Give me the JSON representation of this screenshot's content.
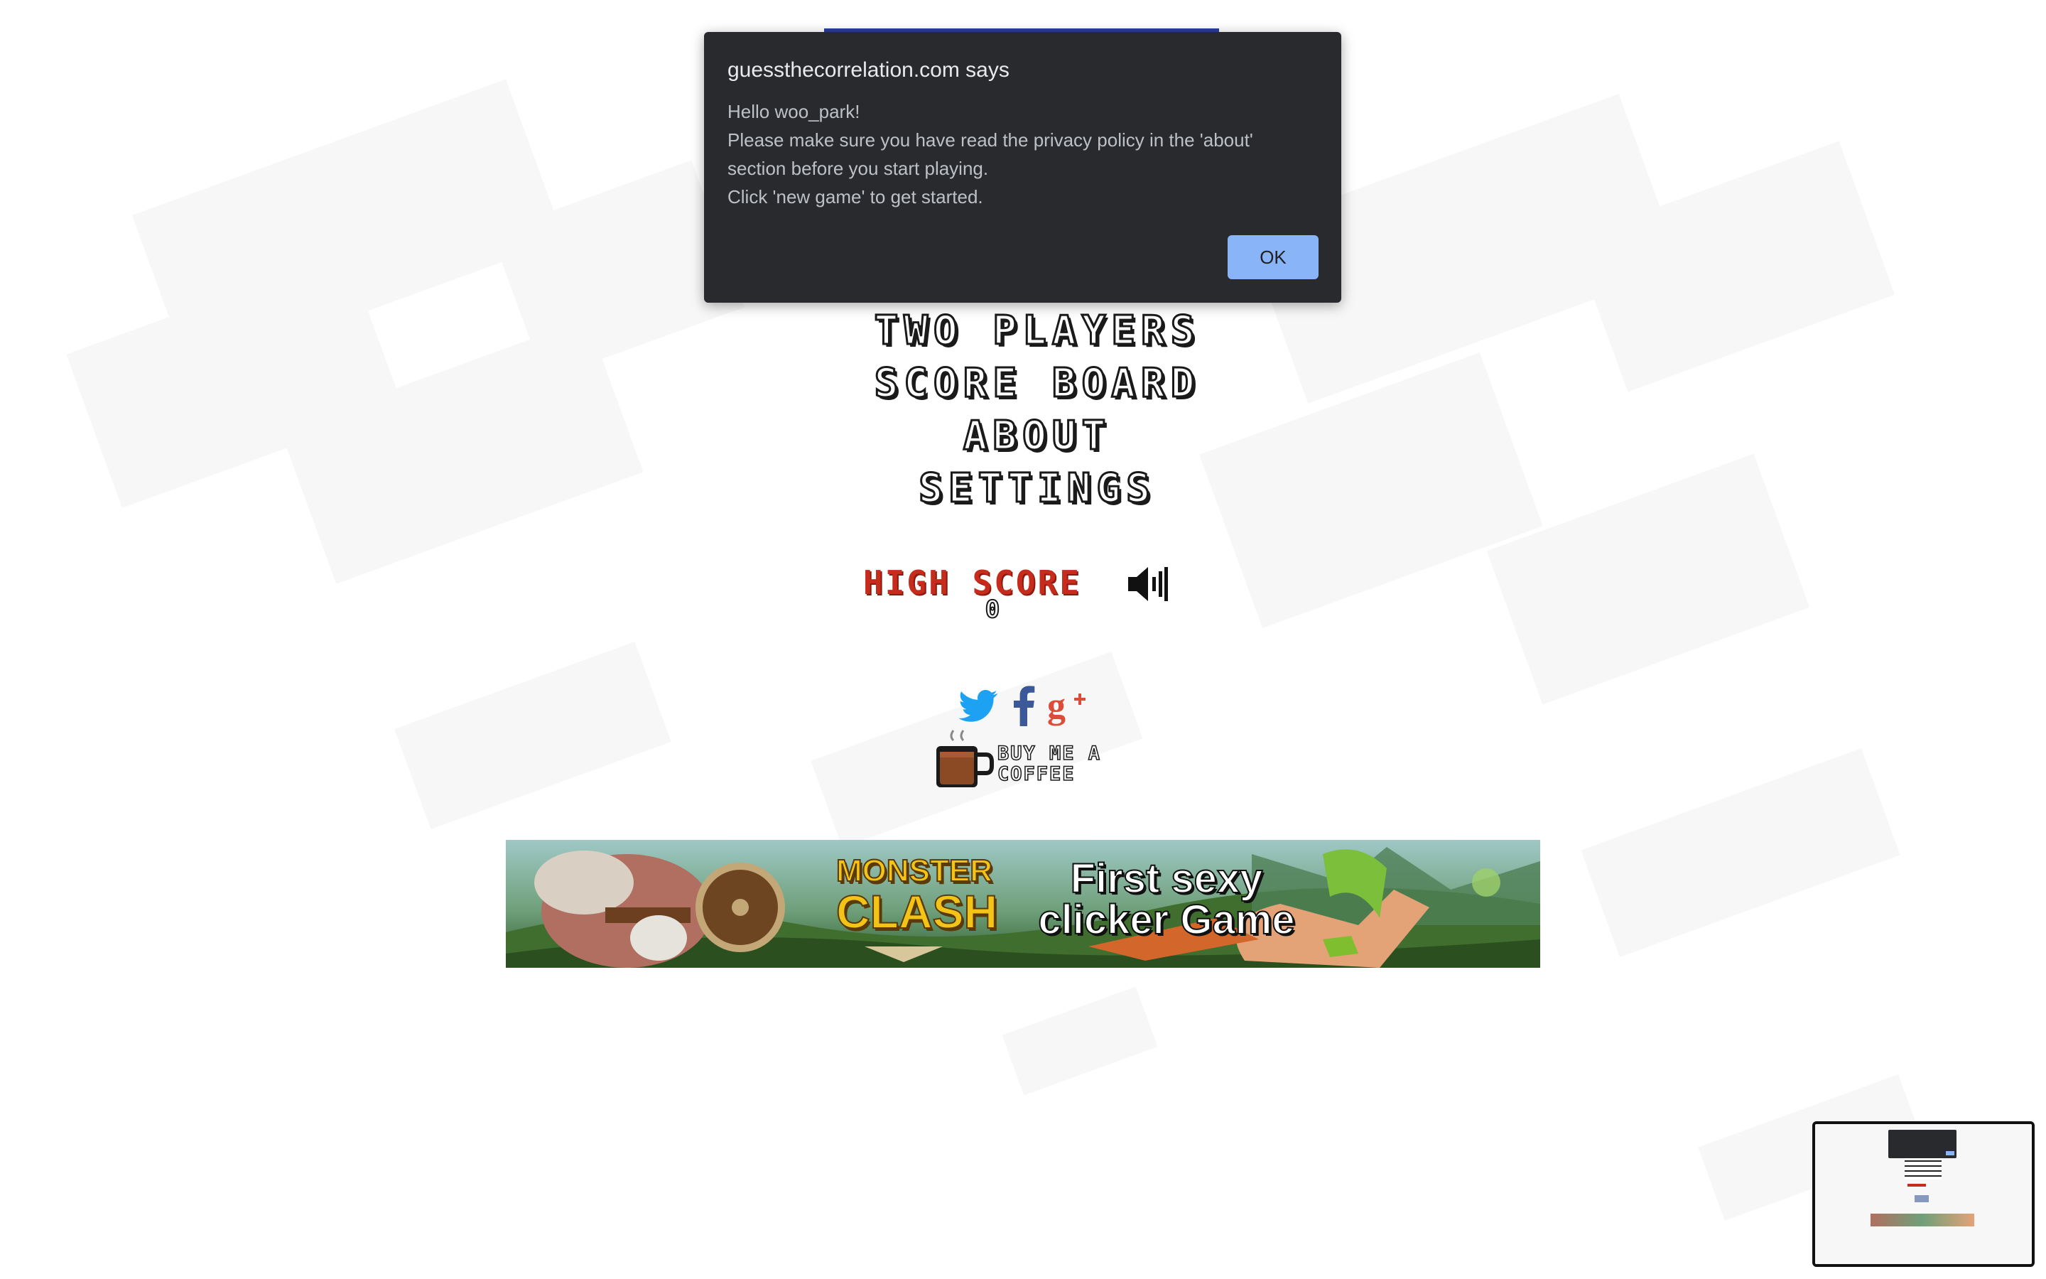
{
  "dialog": {
    "title": "guessthecorrelation.com says",
    "lines": [
      "Hello woo_park!",
      "Please make sure you have read the privacy policy in the 'about'",
      "section before you start playing.",
      "Click 'new game' to get started."
    ],
    "ok_label": "OK"
  },
  "menu": {
    "items": [
      "Two players",
      "Score board",
      "About",
      "Settings"
    ]
  },
  "highscore": {
    "label": "High score",
    "value": "0"
  },
  "sound": {
    "icon": "speaker-icon",
    "state": "on"
  },
  "social": {
    "icons": [
      "twitter-icon",
      "facebook-icon",
      "google-plus-icon"
    ]
  },
  "coffee": {
    "icon": "coffee-cup-icon",
    "line1": "BUY ME A",
    "line2": "COFFEE"
  },
  "ad": {
    "logo_line1": "MONSTER",
    "logo_line2": "CLASH",
    "line1": "First sexy",
    "line2": "clicker Game"
  },
  "colors": {
    "highscore_red": "#c62b1c",
    "dialog_bg": "#292a2d",
    "ok_button": "#8ab4f8",
    "twitter_blue": "#1da1f2",
    "facebook_blue": "#3b5998",
    "google_red": "#dd4b39"
  }
}
